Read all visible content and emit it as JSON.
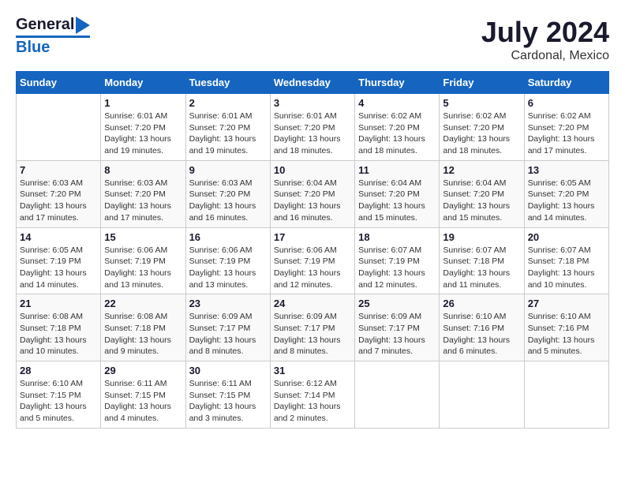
{
  "header": {
    "logo_general": "General",
    "logo_blue": "Blue",
    "title": "July 2024",
    "subtitle": "Cardonal, Mexico"
  },
  "days_of_week": [
    "Sunday",
    "Monday",
    "Tuesday",
    "Wednesday",
    "Thursday",
    "Friday",
    "Saturday"
  ],
  "weeks": [
    [
      {
        "day": "",
        "info": ""
      },
      {
        "day": "1",
        "info": "Sunrise: 6:01 AM\nSunset: 7:20 PM\nDaylight: 13 hours\nand 19 minutes."
      },
      {
        "day": "2",
        "info": "Sunrise: 6:01 AM\nSunset: 7:20 PM\nDaylight: 13 hours\nand 19 minutes."
      },
      {
        "day": "3",
        "info": "Sunrise: 6:01 AM\nSunset: 7:20 PM\nDaylight: 13 hours\nand 18 minutes."
      },
      {
        "day": "4",
        "info": "Sunrise: 6:02 AM\nSunset: 7:20 PM\nDaylight: 13 hours\nand 18 minutes."
      },
      {
        "day": "5",
        "info": "Sunrise: 6:02 AM\nSunset: 7:20 PM\nDaylight: 13 hours\nand 18 minutes."
      },
      {
        "day": "6",
        "info": "Sunrise: 6:02 AM\nSunset: 7:20 PM\nDaylight: 13 hours\nand 17 minutes."
      }
    ],
    [
      {
        "day": "7",
        "info": "Sunrise: 6:03 AM\nSunset: 7:20 PM\nDaylight: 13 hours\nand 17 minutes."
      },
      {
        "day": "8",
        "info": "Sunrise: 6:03 AM\nSunset: 7:20 PM\nDaylight: 13 hours\nand 17 minutes."
      },
      {
        "day": "9",
        "info": "Sunrise: 6:03 AM\nSunset: 7:20 PM\nDaylight: 13 hours\nand 16 minutes."
      },
      {
        "day": "10",
        "info": "Sunrise: 6:04 AM\nSunset: 7:20 PM\nDaylight: 13 hours\nand 16 minutes."
      },
      {
        "day": "11",
        "info": "Sunrise: 6:04 AM\nSunset: 7:20 PM\nDaylight: 13 hours\nand 15 minutes."
      },
      {
        "day": "12",
        "info": "Sunrise: 6:04 AM\nSunset: 7:20 PM\nDaylight: 13 hours\nand 15 minutes."
      },
      {
        "day": "13",
        "info": "Sunrise: 6:05 AM\nSunset: 7:20 PM\nDaylight: 13 hours\nand 14 minutes."
      }
    ],
    [
      {
        "day": "14",
        "info": "Sunrise: 6:05 AM\nSunset: 7:19 PM\nDaylight: 13 hours\nand 14 minutes."
      },
      {
        "day": "15",
        "info": "Sunrise: 6:06 AM\nSunset: 7:19 PM\nDaylight: 13 hours\nand 13 minutes."
      },
      {
        "day": "16",
        "info": "Sunrise: 6:06 AM\nSunset: 7:19 PM\nDaylight: 13 hours\nand 13 minutes."
      },
      {
        "day": "17",
        "info": "Sunrise: 6:06 AM\nSunset: 7:19 PM\nDaylight: 13 hours\nand 12 minutes."
      },
      {
        "day": "18",
        "info": "Sunrise: 6:07 AM\nSunset: 7:19 PM\nDaylight: 13 hours\nand 12 minutes."
      },
      {
        "day": "19",
        "info": "Sunrise: 6:07 AM\nSunset: 7:18 PM\nDaylight: 13 hours\nand 11 minutes."
      },
      {
        "day": "20",
        "info": "Sunrise: 6:07 AM\nSunset: 7:18 PM\nDaylight: 13 hours\nand 10 minutes."
      }
    ],
    [
      {
        "day": "21",
        "info": "Sunrise: 6:08 AM\nSunset: 7:18 PM\nDaylight: 13 hours\nand 10 minutes."
      },
      {
        "day": "22",
        "info": "Sunrise: 6:08 AM\nSunset: 7:18 PM\nDaylight: 13 hours\nand 9 minutes."
      },
      {
        "day": "23",
        "info": "Sunrise: 6:09 AM\nSunset: 7:17 PM\nDaylight: 13 hours\nand 8 minutes."
      },
      {
        "day": "24",
        "info": "Sunrise: 6:09 AM\nSunset: 7:17 PM\nDaylight: 13 hours\nand 8 minutes."
      },
      {
        "day": "25",
        "info": "Sunrise: 6:09 AM\nSunset: 7:17 PM\nDaylight: 13 hours\nand 7 minutes."
      },
      {
        "day": "26",
        "info": "Sunrise: 6:10 AM\nSunset: 7:16 PM\nDaylight: 13 hours\nand 6 minutes."
      },
      {
        "day": "27",
        "info": "Sunrise: 6:10 AM\nSunset: 7:16 PM\nDaylight: 13 hours\nand 5 minutes."
      }
    ],
    [
      {
        "day": "28",
        "info": "Sunrise: 6:10 AM\nSunset: 7:15 PM\nDaylight: 13 hours\nand 5 minutes."
      },
      {
        "day": "29",
        "info": "Sunrise: 6:11 AM\nSunset: 7:15 PM\nDaylight: 13 hours\nand 4 minutes."
      },
      {
        "day": "30",
        "info": "Sunrise: 6:11 AM\nSunset: 7:15 PM\nDaylight: 13 hours\nand 3 minutes."
      },
      {
        "day": "31",
        "info": "Sunrise: 6:12 AM\nSunset: 7:14 PM\nDaylight: 13 hours\nand 2 minutes."
      },
      {
        "day": "",
        "info": ""
      },
      {
        "day": "",
        "info": ""
      },
      {
        "day": "",
        "info": ""
      }
    ]
  ]
}
